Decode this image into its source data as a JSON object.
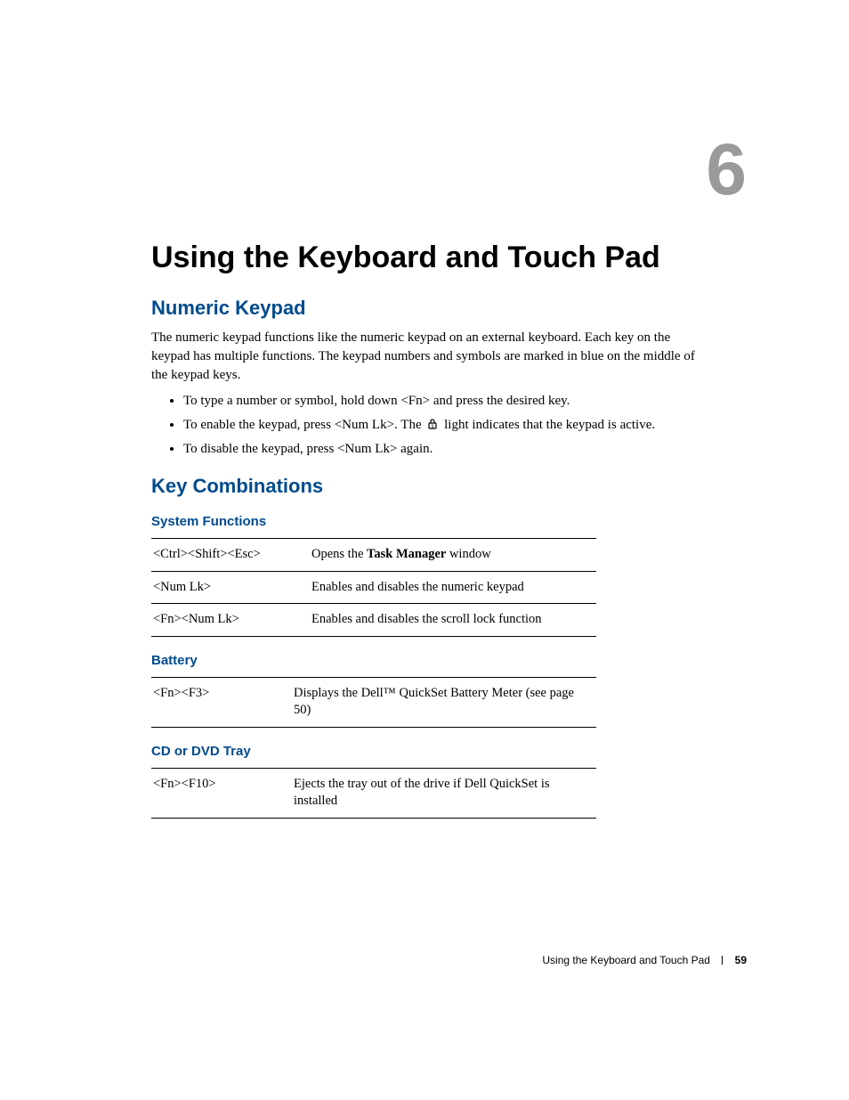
{
  "chapter_number": "6",
  "title": "Using the Keyboard and Touch Pad",
  "sections": {
    "numeric_keypad": {
      "heading": "Numeric Keypad",
      "intro": "The numeric keypad functions like the numeric keypad on an external keyboard. Each key on the keypad has multiple functions. The keypad numbers and symbols are marked in blue on the middle of the keypad keys.",
      "bullets": {
        "b1": "To type a number or symbol, hold down <Fn> and press the desired key.",
        "b2_pre": "To enable the keypad, press <Num Lk>. The ",
        "b2_post": " light indicates that the keypad is active.",
        "b3": "To disable the keypad, press <Num Lk> again."
      }
    },
    "key_combinations": {
      "heading": "Key Combinations",
      "system_functions": {
        "heading": "System Functions",
        "rows": [
          {
            "keys": "<Ctrl><Shift><Esc>",
            "desc_pre": "Opens the ",
            "desc_bold": "Task Manager",
            "desc_post": " window"
          },
          {
            "keys": "<Num Lk>",
            "desc": "Enables and disables the numeric keypad"
          },
          {
            "keys": "<Fn><Num Lk>",
            "desc": "Enables and disables the scroll lock function"
          }
        ]
      },
      "battery": {
        "heading": "Battery",
        "rows": [
          {
            "keys": "<Fn><F3>",
            "desc": "Displays the Dell™ QuickSet Battery Meter (see page 50)"
          }
        ]
      },
      "cd_dvd": {
        "heading": "CD or DVD Tray",
        "rows": [
          {
            "keys": "<Fn><F10>",
            "desc": "Ejects the tray out of the drive if Dell QuickSet is installed"
          }
        ]
      }
    }
  },
  "footer": {
    "text": "Using the Keyboard and Touch Pad",
    "page": "59"
  }
}
